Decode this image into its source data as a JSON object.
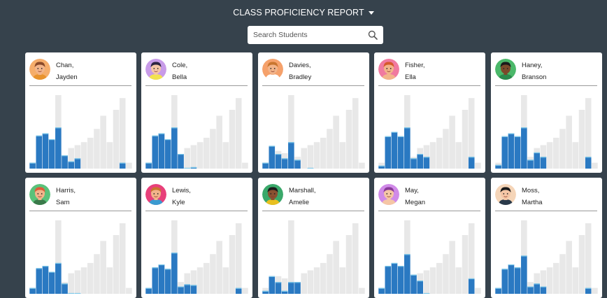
{
  "header": {
    "title": "CLASS PROFICIENCY REPORT"
  },
  "search": {
    "placeholder": "Search Students",
    "value": ""
  },
  "colors": {
    "background": "#36424c",
    "reference_bar": "#e8e8e8",
    "student_bar": "#2a79c2",
    "highlight": "#7fcaea"
  },
  "students": [
    {
      "last": "Chan,",
      "first": "Jayden",
      "avatar": {
        "skin": "#f2b48a",
        "hair": "#8a4a2a",
        "bg": "#f5ad6b",
        "shirt": "#e8932e"
      },
      "bars": [
        0.08,
        0.45,
        0.48,
        0.4,
        0.56,
        0.18,
        0.1,
        0.14,
        0,
        0,
        0,
        0,
        0,
        0,
        0.08,
        0
      ]
    },
    {
      "last": "Cole,",
      "first": "Bella",
      "avatar": {
        "skin": "#f5c6a5",
        "hair": "#2c2440",
        "bg": "#c89be8",
        "shirt": "#f2e24f"
      },
      "bars": [
        0.08,
        0.45,
        0.48,
        0.4,
        0.56,
        0.2,
        0.01,
        0.02,
        0,
        0,
        0,
        0,
        0,
        0,
        0,
        0
      ]
    },
    {
      "last": "Davies,",
      "first": "Bradley",
      "avatar": {
        "skin": "#f2b48a",
        "hair": "#c9762f",
        "bg": "#f5a16b",
        "shirt": "#ffffff"
      },
      "bars": [
        0.08,
        0.31,
        0.2,
        0.14,
        0.36,
        0.12,
        0,
        0.01,
        0,
        0,
        0,
        0,
        0,
        0,
        0,
        0
      ]
    },
    {
      "last": "Fisher,",
      "first": "Ella",
      "avatar": {
        "skin": "#f2b48a",
        "hair": "#d65a2c",
        "bg": "#f07aa0",
        "shirt": "#f2b48a"
      },
      "bars": [
        0.04,
        0.44,
        0.5,
        0.44,
        0.56,
        0.14,
        0.2,
        0.16,
        0,
        0,
        0,
        0,
        0,
        0,
        0.16,
        0
      ]
    },
    {
      "last": "Haney,",
      "first": "Branson",
      "avatar": {
        "skin": "#7a4a2a",
        "hair": "#1a1a1a",
        "bg": "#4bb86a",
        "shirt": "#2b8a4c"
      },
      "bars": [
        0.05,
        0.44,
        0.48,
        0.44,
        0.56,
        0.12,
        0.22,
        0.16,
        0,
        0,
        0,
        0,
        0,
        0,
        0.16,
        0
      ]
    },
    {
      "last": "Harris,",
      "first": "Sam",
      "avatar": {
        "skin": "#f2b48a",
        "hair": "#e05a3a",
        "bg": "#5ac27a",
        "shirt": "#3a7a4a"
      },
      "bars": [
        0.08,
        0.35,
        0.38,
        0.3,
        0.42,
        0.14,
        0.01,
        0.01,
        0,
        0,
        0,
        0,
        0,
        0,
        0,
        0
      ]
    },
    {
      "last": "Lewis,",
      "first": "Kyle",
      "avatar": {
        "skin": "#f2b48a",
        "hair": "#c9762f",
        "bg": "#e8407a",
        "shirt": "#3a9ad0"
      },
      "bars": [
        0.08,
        0.36,
        0.4,
        0.34,
        0.56,
        0.1,
        0.13,
        0.12,
        0,
        0,
        0,
        0,
        0,
        0,
        0.08,
        0
      ]
    },
    {
      "last": "Marshall,",
      "first": "Amelie",
      "avatar": {
        "skin": "#8a5030",
        "hair": "#1a1a1a",
        "bg": "#3aa86a",
        "shirt": "#e8c020"
      },
      "bars": [
        0.04,
        0.24,
        0.16,
        0.04,
        0.16,
        0.16,
        0,
        0,
        0,
        0,
        0,
        0,
        0,
        0,
        0,
        0
      ]
    },
    {
      "last": "May,",
      "first": "Megan",
      "avatar": {
        "skin": "#f5c6a5",
        "hair": "#8a3a9a",
        "bg": "#d08ae8",
        "shirt": "#f5c6a5"
      },
      "bars": [
        0.08,
        0.38,
        0.42,
        0.38,
        0.54,
        0.26,
        0.18,
        0.01,
        0,
        0,
        0,
        0,
        0,
        0,
        0.21,
        0
      ]
    },
    {
      "last": "Moss,",
      "first": "Martha",
      "avatar": {
        "skin": "#f5c6a5",
        "hair": "#1a1a1a",
        "bg": "#f5d5b8",
        "shirt": "#2a3a4a"
      },
      "bars": [
        0.08,
        0.34,
        0.4,
        0.36,
        0.52,
        0.1,
        0.14,
        0.1,
        0,
        0,
        0,
        0,
        0,
        0,
        0.08,
        0
      ]
    }
  ],
  "reference_bars": [
    0.08,
    0.2,
    0.24,
    0.21,
    1.0,
    0.16,
    0.28,
    0.32,
    0.36,
    0.42,
    0.54,
    0.72,
    0.36,
    0.8,
    0.96,
    0.08
  ]
}
